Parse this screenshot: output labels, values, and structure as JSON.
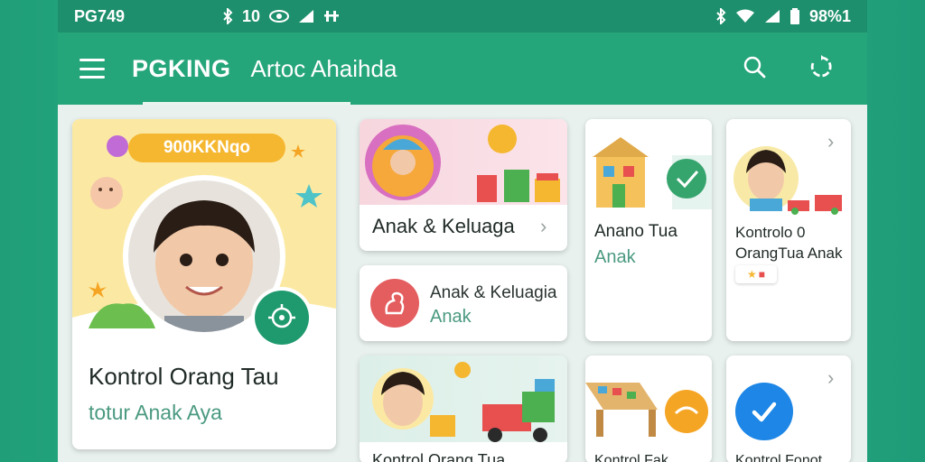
{
  "status_bar": {
    "carrier": "PG749",
    "indicators": "10",
    "battery_percent": "98%1"
  },
  "app_bar": {
    "brand": "PGKING",
    "subtitle": "Artoc Ahaihda"
  },
  "cards": {
    "featured": {
      "tag": "900KKNqo",
      "title": "Kontrol Orang Tau",
      "subtitle": "totur Anak Aya"
    },
    "family": {
      "title": "Anak & Keluaga"
    },
    "family_small": {
      "title": "Anak & Keluagia",
      "subtitle": "Anak"
    },
    "parent": {
      "title": "Anano Tua",
      "subtitle": "Anak"
    },
    "control": {
      "title": "Kontrolo 0 OrangTua Anak"
    },
    "bottom_left": {
      "title": "Kontrol Orang Tua"
    },
    "bottom_mid": {
      "title": "Kontrol Fak"
    },
    "bottom_right": {
      "title": "Kontrol Fonot"
    }
  },
  "colors": {
    "primary": "#25a57a",
    "status_bar": "#1e8f6c",
    "accent_text": "#4b9a82",
    "tag": "#f5b730",
    "check": "#1d86e6"
  },
  "icons": [
    "menu-icon",
    "search-icon",
    "refresh-icon",
    "chevron-right-icon",
    "check-icon",
    "bluetooth-icon",
    "wifi-icon",
    "signal-icon",
    "battery-icon"
  ]
}
